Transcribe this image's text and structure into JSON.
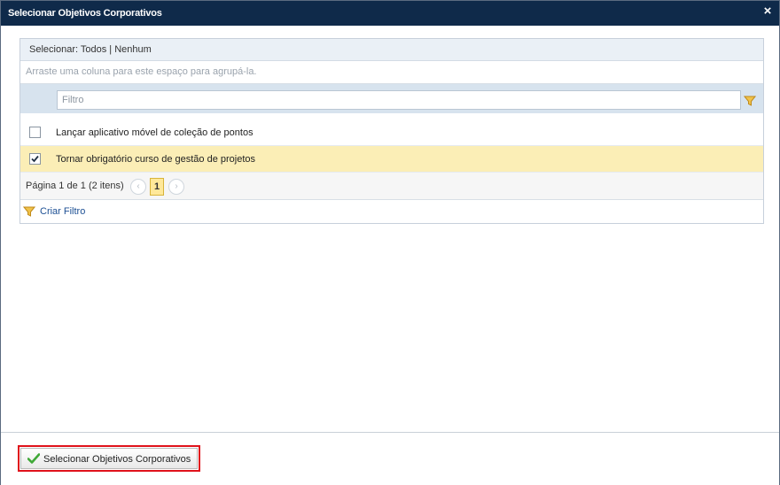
{
  "dialog": {
    "title": "Selecionar Objetivos Corporativos",
    "close_label": "×"
  },
  "grid": {
    "select_prefix": "Selecionar: ",
    "select_all": "Todos",
    "select_separator": " | ",
    "select_none": "Nenhum",
    "group_hint": "Arraste uma coluna para este espaço para agrupá-la.",
    "filter_placeholder": "Filtro",
    "rows": [
      {
        "label": "Lançar aplicativo móvel de coleção de pontos",
        "checked": false
      },
      {
        "label": "Tornar obrigatório curso de gestão de projetos",
        "checked": true
      }
    ],
    "pager": {
      "info": "Página 1 de 1 (2 itens)",
      "current_page": "1",
      "prev_glyph": "‹",
      "next_glyph": "›"
    },
    "create_filter": "Criar Filtro"
  },
  "footer": {
    "confirm_label": "Selecionar Objetivos Corporativos"
  },
  "colors": {
    "titlebar": "#0f2a4a",
    "selected_row": "#fbeeb6",
    "highlight_border": "#e0121b",
    "filter_icon": "#e0a82e",
    "check_icon": "#4caf3a"
  },
  "icons": [
    "close-icon",
    "filter-icon",
    "checkbox-icon",
    "checkmark-icon",
    "chevron-left-icon",
    "chevron-right-icon"
  ]
}
